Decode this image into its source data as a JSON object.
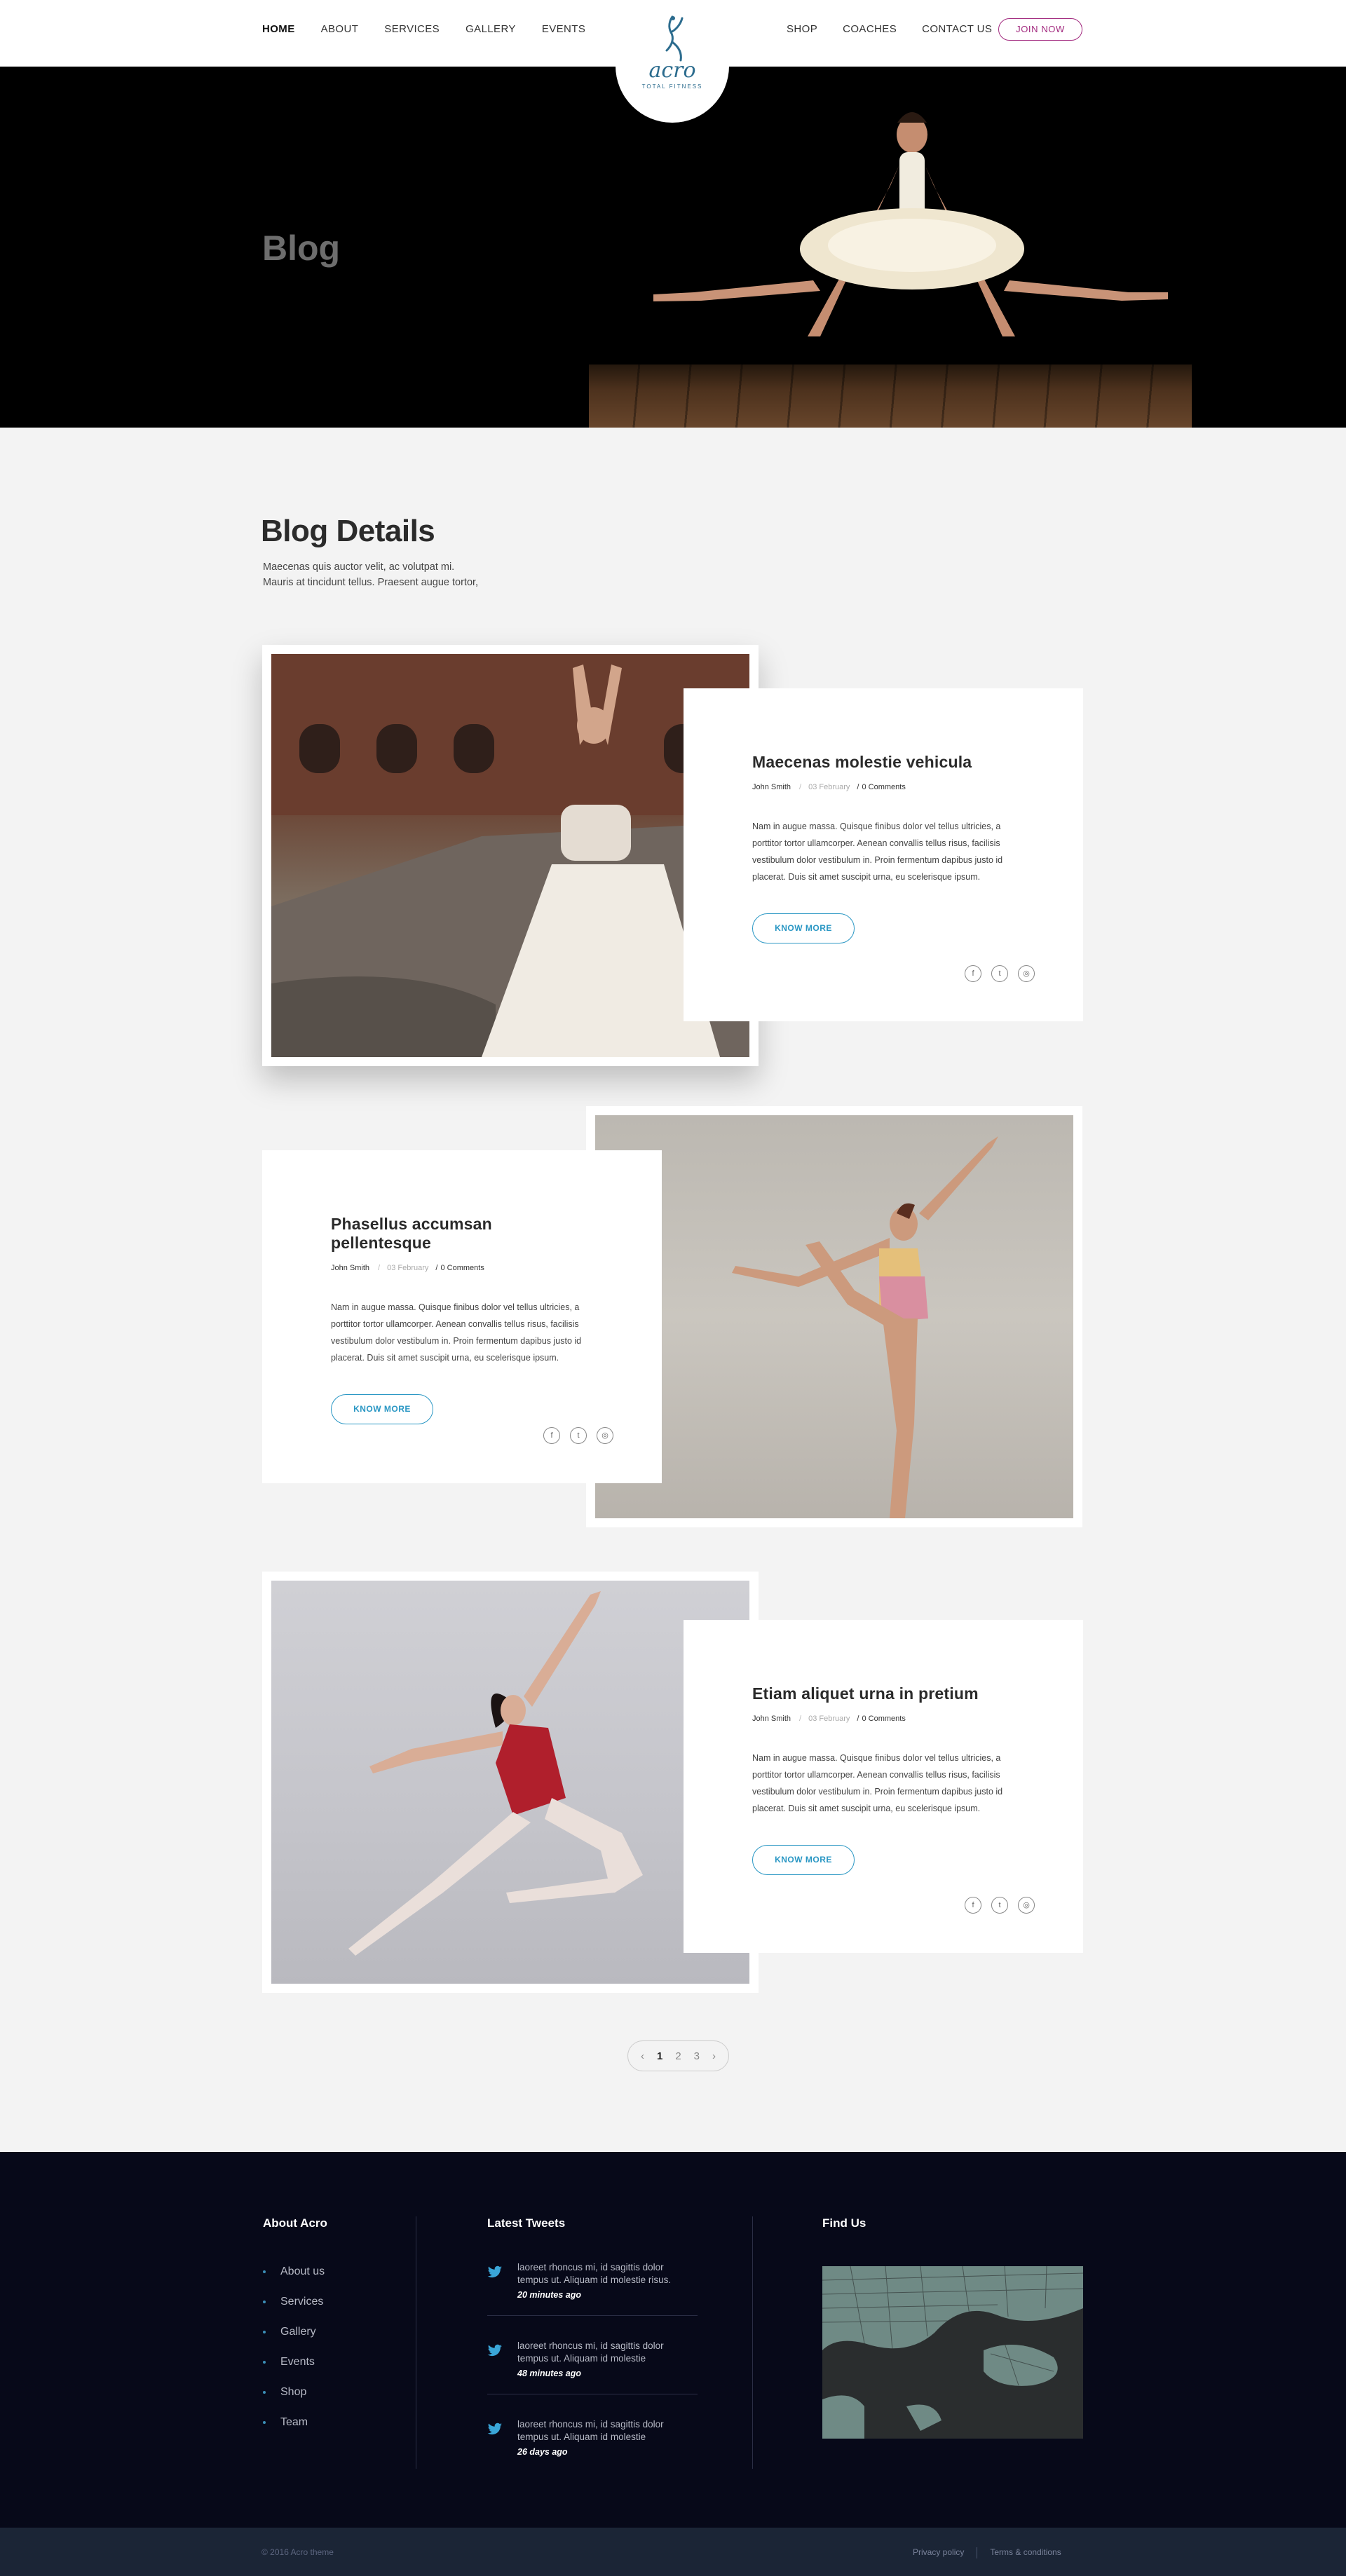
{
  "header": {
    "nav_left": [
      {
        "label": "HOME"
      },
      {
        "label": "ABOUT"
      },
      {
        "label": "SERVICES"
      },
      {
        "label": "GALLERY"
      },
      {
        "label": "EVENTS"
      }
    ],
    "nav_right": [
      {
        "label": "SHOP"
      },
      {
        "label": "COACHES"
      },
      {
        "label": "CONTACT US"
      }
    ],
    "join_label": "JOIN NOW",
    "logo": {
      "word": "acro",
      "sub": "TOTAL FITNESS"
    }
  },
  "hero": {
    "title": "Blog"
  },
  "section": {
    "title": "Blog Details",
    "subtitle_line1": "Maecenas quis auctor velit, ac volutpat mi.",
    "subtitle_line2": "Mauris at tincidunt tellus. Praesent augue tortor,"
  },
  "posts": [
    {
      "title": "Maecenas molestie vehicula",
      "author": "John Smith",
      "date": "03 February",
      "comments": "0 Comments",
      "body": "Nam in augue massa. Quisque finibus dolor vel tellus ultricies, a porttitor tortor ullamcorper. Aenean convallis tellus risus, facilisis vestibulum dolor vestibulum in. Proin fermentum dapibus justo id placerat. Duis sit amet suscipit urna, eu scelerisque ipsum.",
      "button": "KNOW MORE"
    },
    {
      "title": "Phasellus accumsan pellentesque",
      "author": "John Smith",
      "date": "03 February",
      "comments": "0 Comments",
      "body": "Nam in augue massa. Quisque finibus dolor vel tellus ultricies, a porttitor tortor ullamcorper. Aenean convallis tellus risus, facilisis vestibulum dolor vestibulum in. Proin fermentum dapibus justo id placerat. Duis sit amet suscipit urna, eu scelerisque ipsum.",
      "button": "KNOW MORE"
    },
    {
      "title": "Etiam aliquet urna in pretium",
      "author": "John Smith",
      "date": "03 February",
      "comments": "0 Comments",
      "body": "Nam in augue massa. Quisque finibus dolor vel tellus ultricies, a porttitor tortor ullamcorper. Aenean convallis tellus risus, facilisis vestibulum dolor vestibulum in. Proin fermentum dapibus justo id placerat. Duis sit amet suscipit urna, eu scelerisque ipsum.",
      "button": "KNOW MORE"
    }
  ],
  "social_icons": [
    "facebook-icon",
    "twitter-icon",
    "instagram-icon"
  ],
  "pagination": {
    "prev": "‹",
    "pages": [
      "1",
      "2",
      "3"
    ],
    "next": "›",
    "current": "1"
  },
  "footer": {
    "about_title": "About Acro",
    "links": [
      "About us",
      "Services",
      "Gallery",
      "Events",
      "Shop",
      "Team"
    ],
    "tweets_title": "Latest Tweets",
    "tweets": [
      {
        "line1": "laoreet rhoncus mi, id sagittis dolor",
        "line2": "tempus ut. Aliquam id molestie risus.",
        "time": "20 minutes ago"
      },
      {
        "line1": "laoreet rhoncus mi, id sagittis dolor",
        "line2": "tempus ut. Aliquam id molestie",
        "time": "48 minutes ago"
      },
      {
        "line1": "laoreet rhoncus mi, id sagittis dolor",
        "line2": "tempus ut. Aliquam id molestie",
        "time": "26 days ago"
      }
    ],
    "find_title": "Find Us",
    "copyright": "© 2016 Acro theme",
    "privacy": "Privacy policy",
    "terms": "Terms & conditions"
  },
  "colors": {
    "accent": "#2a97c4",
    "join": "#a22a7f",
    "footer_bg": "#070919",
    "bottom_bar": "#1b2536"
  }
}
